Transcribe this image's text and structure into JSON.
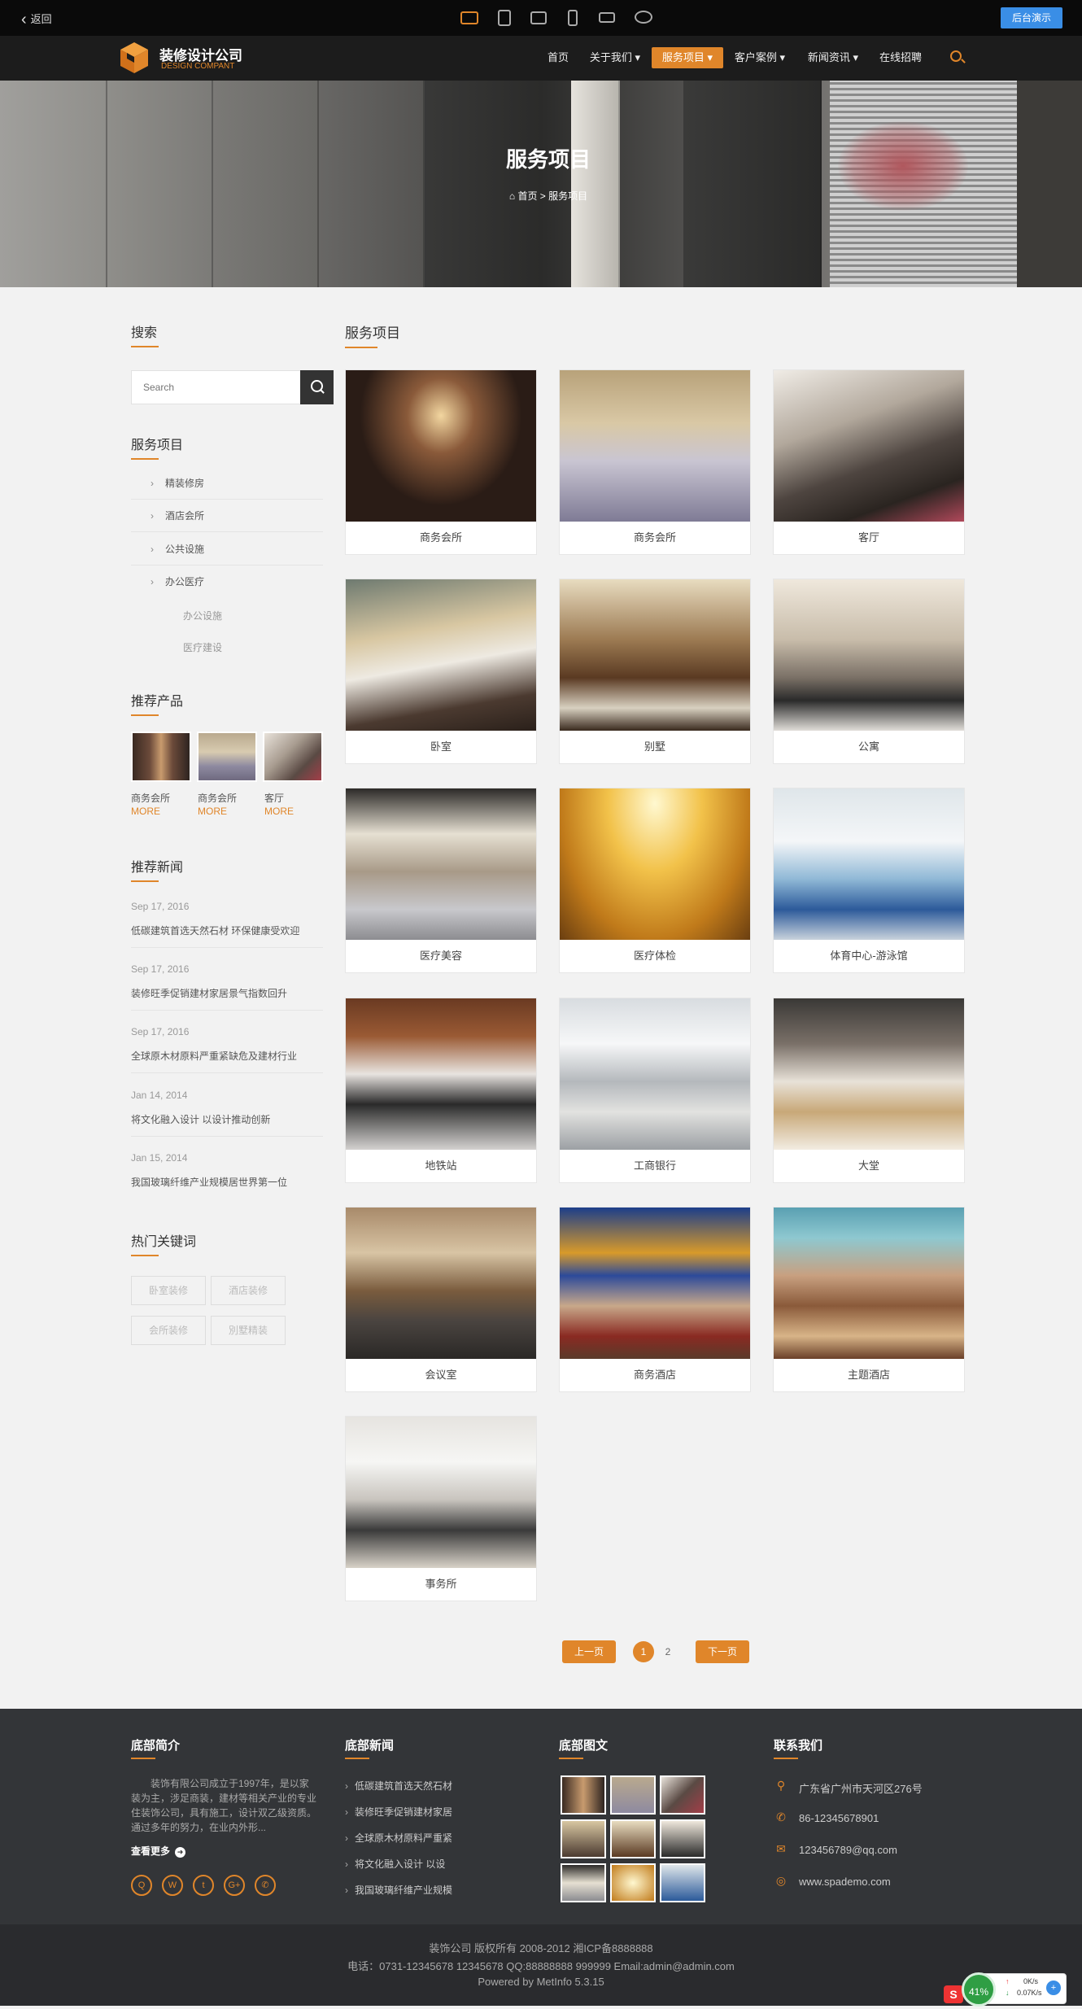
{
  "topbar": {
    "back_label": "返回",
    "devices": [
      "desktop-icon",
      "tablet-icon",
      "tablet-landscape-icon",
      "phone-icon",
      "phone-landscape-icon",
      "wechat-icon"
    ],
    "demo_label": "后台演示"
  },
  "nav": {
    "logo_title": "装修设计公司",
    "logo_sub": "DESIGN COMPANT",
    "items": [
      {
        "label": "首页"
      },
      {
        "label": "关于我们 ▾"
      },
      {
        "label": "服务项目 ▾"
      },
      {
        "label": "客户案例 ▾"
      },
      {
        "label": "新闻资讯 ▾"
      },
      {
        "label": "在线招聘"
      }
    ],
    "active": "服务项目"
  },
  "banner": {
    "title": "服务项目",
    "breadcrumb": "⌂ 首页 > 服务项目"
  },
  "sidebar": {
    "search_title": "搜索",
    "search_placeholder": "Search",
    "categories_title": "服务项目",
    "categories": [
      {
        "label": "精装修房"
      },
      {
        "label": "酒店会所"
      },
      {
        "label": "公共设施"
      },
      {
        "label": "办公医疗"
      }
    ],
    "subcategories": [
      {
        "label": "办公设施"
      },
      {
        "label": "医疗建设"
      }
    ],
    "products_title": "推荐产品",
    "products": [
      {
        "name": "商务会所",
        "more": "MORE"
      },
      {
        "name": "商务会所",
        "more": "MORE"
      },
      {
        "name": "客厅",
        "more": "MORE"
      }
    ],
    "news_title": "推荐新闻",
    "news": [
      {
        "date": "Sep 17, 2016",
        "title": "低碳建筑首选天然石材 环保健康受欢迎"
      },
      {
        "date": "Sep 17, 2016",
        "title": "装修旺季促销建材家居景气指数回升"
      },
      {
        "date": "Sep 17, 2016",
        "title": "全球原木材原料严重紧缺危及建材行业"
      },
      {
        "date": "Jan 14, 2014",
        "title": "将文化融入设计 以设计推动创新"
      },
      {
        "date": "Jan 15, 2014",
        "title": "我国玻璃纤维产业规模居世界第一位"
      }
    ],
    "keywords_title": "热门关键词",
    "keywords": [
      {
        "label": "卧室装修"
      },
      {
        "label": "酒店装修"
      },
      {
        "label": "会所装修"
      },
      {
        "label": "別墅精装"
      }
    ]
  },
  "main": {
    "title": "服务项目",
    "items": [
      {
        "caption": "商务会所"
      },
      {
        "caption": "商务会所"
      },
      {
        "caption": "客厅"
      },
      {
        "caption": "卧室"
      },
      {
        "caption": "别墅"
      },
      {
        "caption": "公寓"
      },
      {
        "caption": "医疗美容"
      },
      {
        "caption": "医疗体检"
      },
      {
        "caption": "体育中心-游泳馆"
      },
      {
        "caption": "地铁站"
      },
      {
        "caption": "工商银行"
      },
      {
        "caption": "大堂"
      },
      {
        "caption": "会议室"
      },
      {
        "caption": "商务酒店"
      },
      {
        "caption": "主题酒店"
      },
      {
        "caption": "事务所"
      }
    ],
    "pagination": {
      "prev": "上一页",
      "pages": [
        "1",
        "2"
      ],
      "current": "1",
      "next": "下一页"
    }
  },
  "footer": {
    "about_title": "底部简介",
    "about_text": "装饰有限公司成立于1997年，是以家装为主，涉足商装，建材等相关产业的专业住装饰公司，具有施工，设计双乙级资质。通过多年的努力，在业内外形...",
    "about_more": "查看更多",
    "social": [
      "qq-icon",
      "weibo-icon",
      "twitter-icon",
      "google-plus-icon",
      "wechat-icon"
    ],
    "news_title": "底部新闻",
    "news": [
      {
        "label": "低碳建筑首选天然石材"
      },
      {
        "label": "装修旺季促销建材家居"
      },
      {
        "label": "全球原木材原料严重紧"
      },
      {
        "label": "将文化融入设计 以设"
      },
      {
        "label": "我国玻璃纤维产业规模"
      }
    ],
    "gallery_title": "底部图文",
    "contact_title": "联系我们",
    "contact": [
      {
        "icon": "location-icon",
        "text": "广东省广州市天河区276号"
      },
      {
        "icon": "phone-icon",
        "text": "86-12345678901"
      },
      {
        "icon": "mail-icon",
        "text": "123456789@qq.com"
      },
      {
        "icon": "globe-icon",
        "text": "www.spademo.com"
      }
    ]
  },
  "bottom": {
    "line1": "装饰公司 版权所有 2008-2012 湘ICP备8888888",
    "line2": "电话：0731-12345678 12345678 QQ:88888888 999999 Email:admin@admin.com",
    "line3": "Powered by MetInfo 5.3.15"
  },
  "widget": {
    "percent": "41%",
    "up": "0K/s",
    "down": "0.07K/s"
  },
  "colors": {
    "accent": "#e0862a",
    "nav_bg": "#1c1c1c",
    "footer_bg": "#333538",
    "demo_button": "#3a8ee6"
  }
}
